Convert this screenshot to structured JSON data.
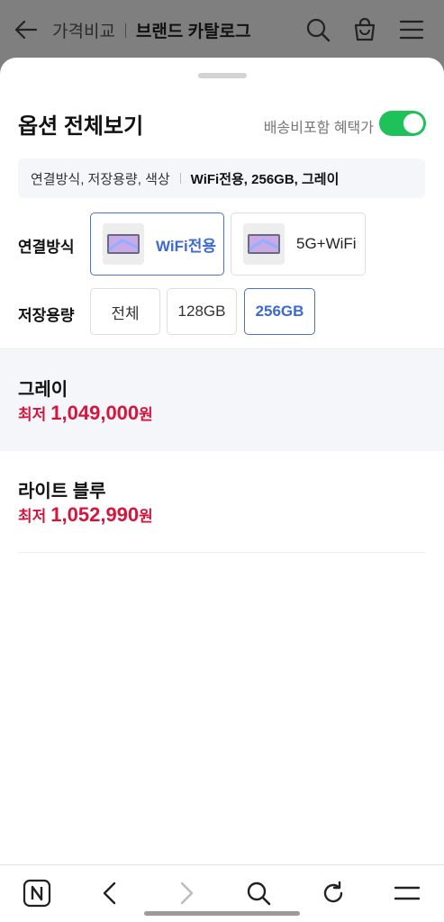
{
  "header": {
    "back_icon": "arrow-left-icon",
    "breadcrumb_parent": "가격비교",
    "breadcrumb_current": "브랜드 카탈로그",
    "icons": [
      "search-icon",
      "shopping-bag-icon",
      "menu-icon"
    ]
  },
  "sheet": {
    "title": "옵션 전체보기",
    "shipping_toggle_label": "배송비포함 혜택가",
    "shipping_toggle_on": true,
    "summary_label": "연결방식, 저장용량, 색상",
    "summary_value": "WiFi전용, 256GB, 그레이",
    "connection": {
      "label": "연결방식",
      "options": [
        {
          "label": "WiFi전용",
          "selected": true
        },
        {
          "label": "5G+WiFi",
          "selected": false
        }
      ]
    },
    "storage": {
      "label": "저장용량",
      "options": [
        {
          "label": "전체",
          "selected": false
        },
        {
          "label": "128GB",
          "selected": false
        },
        {
          "label": "256GB",
          "selected": true
        }
      ]
    },
    "colors": [
      {
        "name": "그레이",
        "price_prefix": "최저",
        "price": "1,049,000",
        "unit": "원",
        "selected": true
      },
      {
        "name": "라이트 블루",
        "price_prefix": "최저",
        "price": "1,052,990",
        "unit": "원",
        "selected": false
      }
    ]
  },
  "browser_bar": {
    "icons": [
      "naver-home-icon",
      "back-icon",
      "forward-icon",
      "search-icon",
      "refresh-icon",
      "menu-icon"
    ]
  },
  "colors": {
    "accent_blue": "#3c6ad0",
    "price_red": "#d6143c",
    "toggle_green": "#1ec15a",
    "dim_overlay": "#7f7f7f"
  }
}
